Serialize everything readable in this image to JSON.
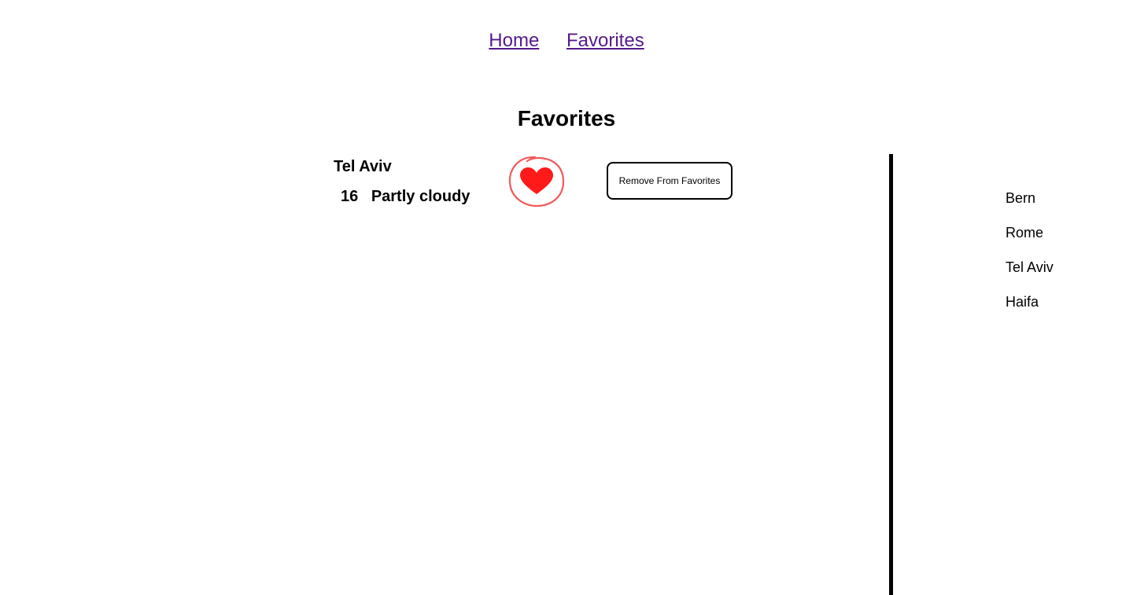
{
  "nav": {
    "links": [
      {
        "label": "Home"
      },
      {
        "label": "Favorites"
      }
    ]
  },
  "page_title": "Favorites",
  "favorite": {
    "city": "Tel Aviv",
    "temperature": "16",
    "condition": "Partly cloudy",
    "heart_icon": "heart-icon",
    "remove_label": "Remove From Favorites"
  },
  "sidebar": {
    "items": [
      {
        "label": "Bern"
      },
      {
        "label": "Rome"
      },
      {
        "label": "Tel Aviv"
      },
      {
        "label": "Haifa"
      }
    ]
  },
  "colors": {
    "link": "#551a8b",
    "heart": "#ff1a1a",
    "heart_ring": "#f05a5a"
  }
}
